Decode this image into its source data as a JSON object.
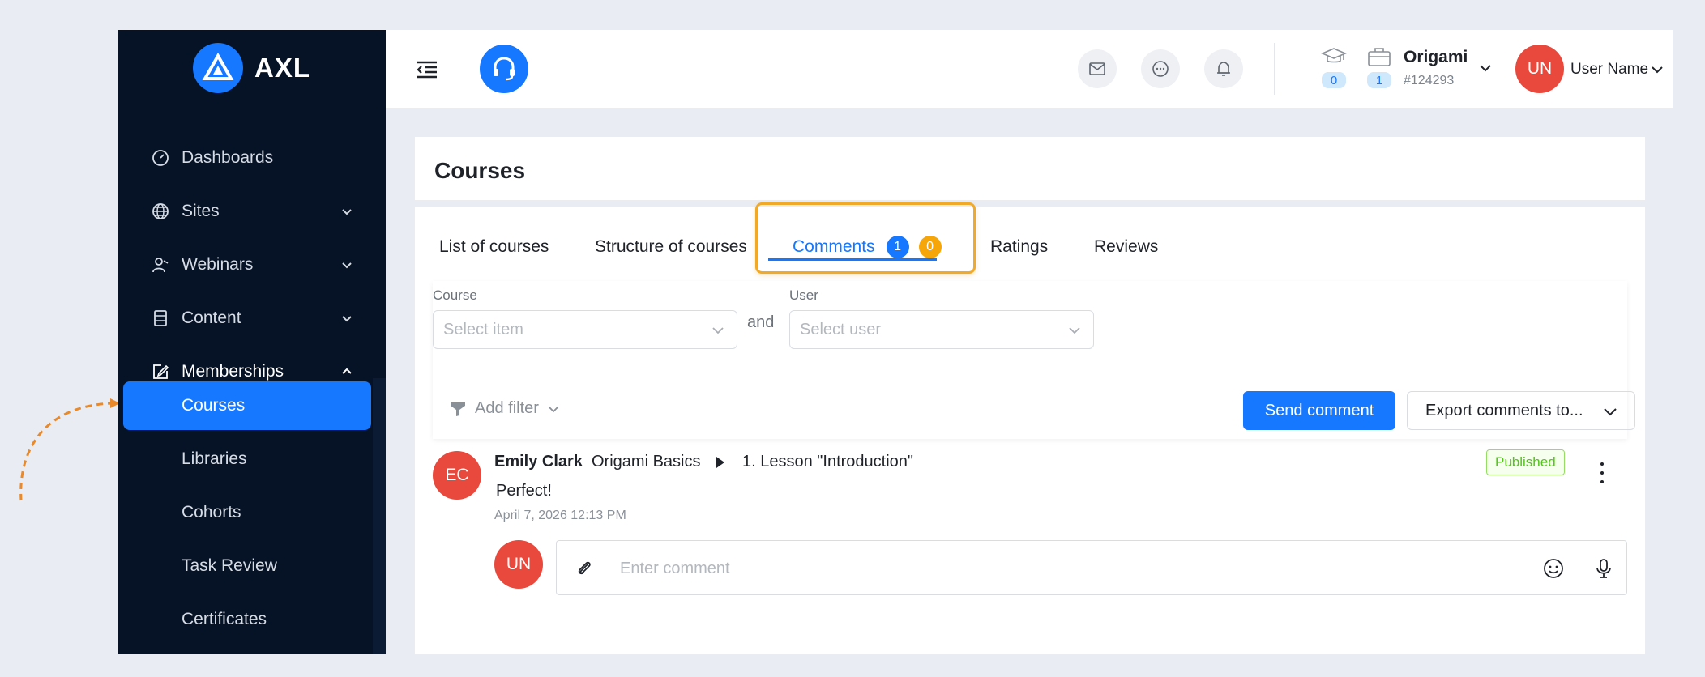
{
  "brand": {
    "name": "AXL"
  },
  "sidebar": {
    "items": [
      {
        "label": "Dashboards",
        "icon": "dashboard-icon"
      },
      {
        "label": "Sites",
        "icon": "globe-icon"
      },
      {
        "label": "Webinars",
        "icon": "webinar-icon"
      },
      {
        "label": "Content",
        "icon": "content-icon"
      },
      {
        "label": "Memberships",
        "icon": "edit-icon"
      }
    ],
    "sub_items": [
      "Courses",
      "Libraries",
      "Cohorts",
      "Task Review",
      "Certificates"
    ],
    "active": "Courses"
  },
  "header": {
    "stats": {
      "courses": "0",
      "packages": "1"
    },
    "org_name": "Origami",
    "org_id": "#124293",
    "avatar_initials": "UN",
    "user_name": "User Name"
  },
  "page": {
    "title": "Courses"
  },
  "tabs": {
    "items": [
      "List of courses",
      "Structure of courses",
      "Comments",
      "Ratings",
      "Reviews"
    ],
    "active": "Comments",
    "comments_count_blue": "1",
    "comments_count_orange": "0"
  },
  "filters": {
    "course_label": "Course",
    "course_placeholder": "Select item",
    "and": "and",
    "user_label": "User",
    "user_placeholder": "Select user",
    "add_filter": "Add filter",
    "send_button": "Send comment",
    "export_button": "Export comments to..."
  },
  "comment": {
    "initials": "EC",
    "author": "Emily Clark",
    "course": "Origami Basics",
    "lesson": "1. Lesson \"Introduction\"",
    "text": "Perfect!",
    "date": "April 7, 2026 12:13 PM",
    "status": "Published"
  },
  "reply": {
    "initials": "UN",
    "placeholder": "Enter comment"
  },
  "colors": {
    "primary": "#1677ff",
    "sidebar": "#061326",
    "highlight": "#f0a928",
    "avatar": "#e8493c",
    "published": "#52c41a"
  }
}
